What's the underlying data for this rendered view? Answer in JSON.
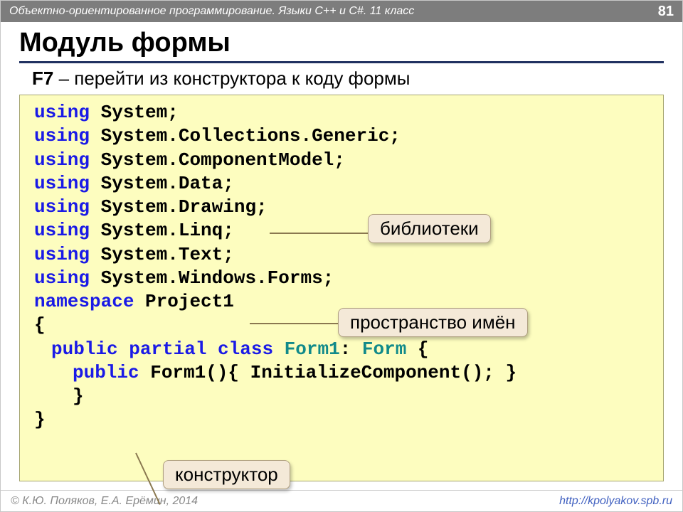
{
  "header": {
    "course": "Объектно-ориентированное программирование. Языки C++ и C#. 11 класс",
    "page": "81"
  },
  "title": "Модуль формы",
  "subtitle": {
    "key": "F7",
    "text": " – перейти из конструктора к коду формы"
  },
  "code": {
    "lines": [
      {
        "tokens": [
          {
            "t": "using ",
            "c": "kw"
          },
          {
            "t": "System;",
            "c": ""
          }
        ]
      },
      {
        "tokens": [
          {
            "t": "using ",
            "c": "kw"
          },
          {
            "t": "System.Collections.Generic;",
            "c": ""
          }
        ]
      },
      {
        "tokens": [
          {
            "t": "using ",
            "c": "kw"
          },
          {
            "t": "System.ComponentModel;",
            "c": ""
          }
        ]
      },
      {
        "tokens": [
          {
            "t": "using ",
            "c": "kw"
          },
          {
            "t": "System.Data;",
            "c": ""
          }
        ]
      },
      {
        "tokens": [
          {
            "t": "using ",
            "c": "kw"
          },
          {
            "t": "System.Drawing;",
            "c": ""
          }
        ]
      },
      {
        "tokens": [
          {
            "t": "using ",
            "c": "kw"
          },
          {
            "t": "System.Linq;",
            "c": ""
          }
        ]
      },
      {
        "tokens": [
          {
            "t": "using ",
            "c": "kw"
          },
          {
            "t": "System.Text;",
            "c": ""
          }
        ]
      },
      {
        "tokens": [
          {
            "t": "using ",
            "c": "kw"
          },
          {
            "t": "System.Windows.Forms;",
            "c": ""
          }
        ]
      },
      {
        "tokens": [
          {
            "t": "namespace ",
            "c": "kw"
          },
          {
            "t": "Project1",
            "c": ""
          }
        ]
      },
      {
        "tokens": [
          {
            "t": "{",
            "c": ""
          }
        ]
      },
      {
        "indent": "indent1",
        "tokens": [
          {
            "t": "public partial class ",
            "c": "kw"
          },
          {
            "t": "Form1",
            "c": "tn"
          },
          {
            "t": ": ",
            "c": ""
          },
          {
            "t": "Form",
            "c": "tn"
          },
          {
            "t": "   {",
            "c": ""
          }
        ]
      },
      {
        "indent": "indent2",
        "tokens": [
          {
            "t": "public ",
            "c": "kw"
          },
          {
            "t": "Form1(){ InitializeComponent(); }",
            "c": ""
          }
        ]
      },
      {
        "indent": "indent2",
        "tokens": [
          {
            "t": "}",
            "c": ""
          }
        ]
      },
      {
        "tokens": [
          {
            "t": "}",
            "c": ""
          }
        ]
      }
    ]
  },
  "callouts": {
    "libraries": "библиотеки",
    "namespace": "пространство имён",
    "constructor": "конструктор"
  },
  "footer": {
    "copyright": "© К.Ю. Поляков, Е.А. Ерёмин, 2014",
    "url_text": "http://kpolyakov.spb.ru"
  }
}
